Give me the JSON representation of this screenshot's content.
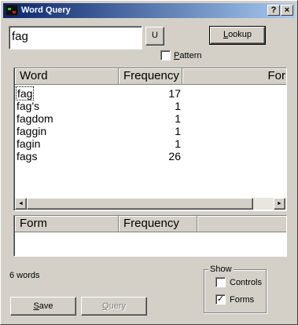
{
  "window": {
    "title": "Word Query",
    "help_label": "?",
    "close_label": "×"
  },
  "search": {
    "value": "fag"
  },
  "u_button": {
    "label": "U"
  },
  "lookup_button": {
    "label_underlined": "L",
    "label_rest": "ookup"
  },
  "pattern_checkbox": {
    "label_underlined": "P",
    "label_rest": "attern",
    "checked": false
  },
  "results_table": {
    "columns": [
      "Word",
      "Frequency",
      "For"
    ],
    "rows": [
      {
        "word": "fag",
        "frequency": "17",
        "selected": true
      },
      {
        "word": "fag's",
        "frequency": "1"
      },
      {
        "word": "fagdom",
        "frequency": "1"
      },
      {
        "word": "faggin",
        "frequency": "1"
      },
      {
        "word": "fagin",
        "frequency": "1"
      },
      {
        "word": "fags",
        "frequency": "26"
      }
    ]
  },
  "forms_table": {
    "columns": [
      "Form",
      "Frequency"
    ]
  },
  "status": {
    "word_count": "6 words"
  },
  "show_group": {
    "label": "Show",
    "controls": {
      "label": "Controls",
      "checked": false,
      "mark": ""
    },
    "forms": {
      "label": "Forms",
      "checked": true,
      "mark": "✓"
    }
  },
  "save_button": {
    "label_underlined": "S",
    "label_rest": "ave"
  },
  "query_button": {
    "label_underlined": "Q",
    "label_rest": "uery",
    "enabled": false
  },
  "scrollbar": {
    "left_arrow": "◄",
    "right_arrow": "►"
  }
}
